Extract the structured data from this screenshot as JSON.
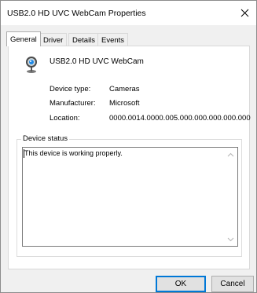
{
  "window": {
    "title": "USB2.0 HD UVC WebCam Properties"
  },
  "tabs": [
    {
      "label": "General",
      "active": true
    },
    {
      "label": "Driver",
      "active": false
    },
    {
      "label": "Details",
      "active": false
    },
    {
      "label": "Events",
      "active": false
    }
  ],
  "device": {
    "name": "USB2.0 HD UVC WebCam",
    "icon": "webcam-icon"
  },
  "properties": [
    {
      "label": "Device type:",
      "value": "Cameras"
    },
    {
      "label": "Manufacturer:",
      "value": "Microsoft"
    },
    {
      "label": "Location:",
      "value": "0000.0014.0000.005.000.000.000.000.000"
    }
  ],
  "device_status": {
    "label": "Device status",
    "text": "This device is working properly."
  },
  "buttons": {
    "ok": "OK",
    "cancel": "Cancel"
  },
  "colors": {
    "accent": "#0078d7"
  }
}
